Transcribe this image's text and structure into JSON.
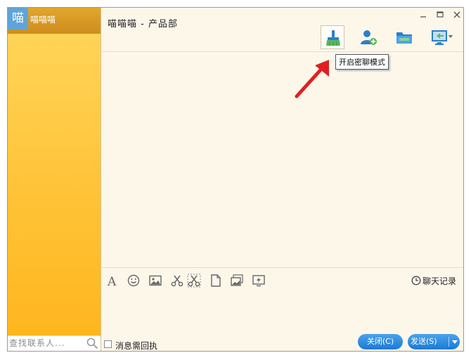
{
  "sidebar": {
    "contact": {
      "avatar_char": "喵",
      "name": "喵喵喵"
    },
    "search": {
      "placeholder": "查找联系人..."
    }
  },
  "header": {
    "title": "喵喵喵 - 产品部",
    "toolbar": {
      "tooltip": "开启密聊模式",
      "buttons": [
        {
          "name": "secret-chat",
          "icon": "broom-icon",
          "active": true
        },
        {
          "name": "add-member",
          "icon": "add-user-icon"
        },
        {
          "name": "file-transfer",
          "icon": "folder-icon"
        },
        {
          "name": "remote-assist",
          "icon": "monitor-icon"
        }
      ]
    }
  },
  "tools": {
    "items": [
      "font-icon",
      "emoji-icon",
      "image-icon",
      "screenshot-icon",
      "screenshot-hide-icon",
      "file-icon",
      "photo-icon",
      "screen-share-icon"
    ],
    "history_label": "聊天记录"
  },
  "footer": {
    "receipt_label": "消息需回执",
    "close_label": "关闭(C)",
    "send_label": "发送(S)"
  },
  "colors": {
    "accent_blue": "#1b79d6",
    "sidebar_yellow": "#ffc43a",
    "arrow_red": "#e02020",
    "background": "#fdf7ea"
  }
}
